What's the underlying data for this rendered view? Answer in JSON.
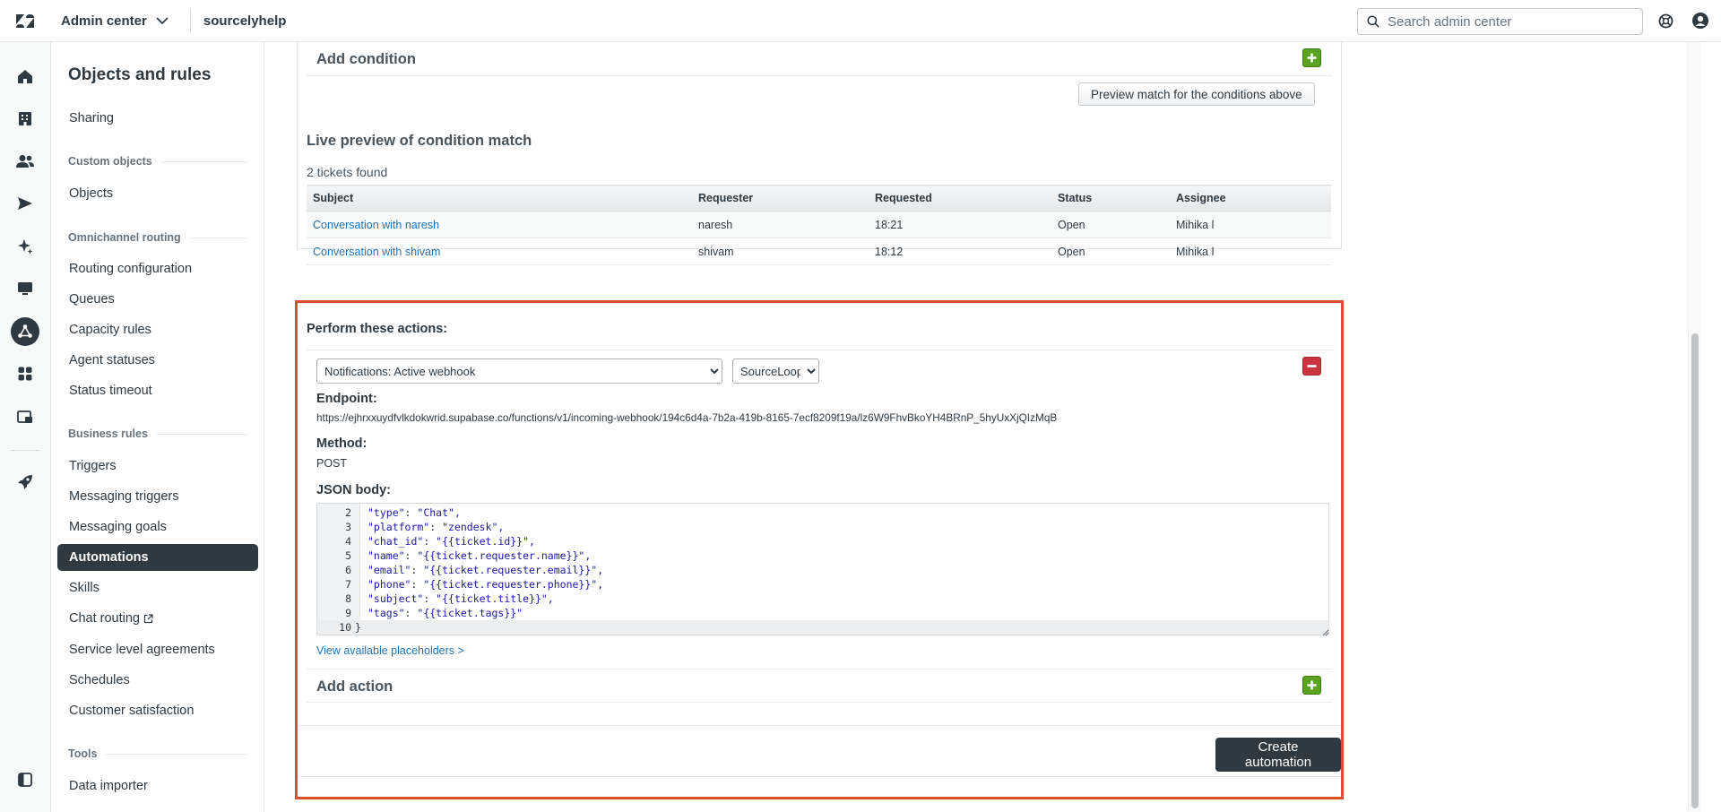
{
  "topbar": {
    "product": "Admin center",
    "account": "sourcelyhelp",
    "search_placeholder": "Search admin center"
  },
  "rail": {
    "icons": [
      "home-icon",
      "building-icon",
      "people-icon",
      "send-icon",
      "sparkle-icon",
      "monitor-icon",
      "objects-rules-icon",
      "apps-icon",
      "workspace-icon",
      "rocket-icon",
      "panel-toggle-icon"
    ]
  },
  "sidebar": {
    "title": "Objects and rules",
    "sharing": "Sharing",
    "custom_objects_group": "Custom objects",
    "objects": "Objects",
    "omnichannel_group": "Omnichannel routing",
    "routing_configuration": "Routing configuration",
    "queues": "Queues",
    "capacity_rules": "Capacity rules",
    "agent_statuses": "Agent statuses",
    "status_timeout": "Status timeout",
    "business_rules_group": "Business rules",
    "triggers": "Triggers",
    "messaging_triggers": "Messaging triggers",
    "messaging_goals": "Messaging goals",
    "automations": "Automations",
    "skills": "Skills",
    "chat_routing": "Chat routing",
    "sla": "Service level agreements",
    "schedules": "Schedules",
    "customer_satisfaction": "Customer satisfaction",
    "tools_group": "Tools",
    "data_importer": "Data importer"
  },
  "conditions": {
    "add_condition": "Add condition",
    "preview_button": "Preview match for the conditions above",
    "live_preview_title": "Live preview of condition match",
    "found_count": "2 tickets found",
    "columns": {
      "subject": "Subject",
      "requester": "Requester",
      "requested": "Requested",
      "status": "Status",
      "assignee": "Assignee"
    },
    "rows": [
      {
        "subject": "Conversation with naresh",
        "requester": "naresh",
        "requested": "18:21",
        "status": "Open",
        "assignee": "Mihika l"
      },
      {
        "subject": "Conversation with shivam",
        "requester": "shivam",
        "requested": "18:12",
        "status": "Open",
        "assignee": "Mihika l"
      }
    ]
  },
  "actions": {
    "title": "Perform these actions:",
    "action_select": "Notifications: Active webhook",
    "webhook_select": "SourceLoop",
    "endpoint_label": "Endpoint:",
    "endpoint_value": "https://ejhrxxuydfvlkdokwrid.supabase.co/functions/v1/incoming-webhook/194c6d4a-7b2a-419b-8165-7ecf8209f19a/lz6W9FhvBkoYH4BRnP_5hyUxXjQIzMqB",
    "method_label": "Method:",
    "method_value": "POST",
    "json_label": "JSON body:",
    "code_lines": [
      {
        "n": "2",
        "key": "\"type\"",
        "val": "\"Chat\","
      },
      {
        "n": "3",
        "key": "\"platform\"",
        "val": "\"zendesk\","
      },
      {
        "n": "4",
        "key": "\"chat_id\"",
        "val": "\"{{ticket.id}}\","
      },
      {
        "n": "5",
        "key": "\"name\"",
        "val": "\"{{ticket.requester.name}}\","
      },
      {
        "n": "6",
        "key": "\"email\"",
        "val": "\"{{ticket.requester.email}}\","
      },
      {
        "n": "7",
        "key": "\"phone\"",
        "val": "\"{{ticket.requester.phone}}\","
      },
      {
        "n": "8",
        "key": "\"subject\"",
        "val": "\"{{ticket.title}}\","
      },
      {
        "n": "9",
        "key": "\"tags\"",
        "val": "\"{{ticket.tags}}\""
      }
    ],
    "last_line_num": "10",
    "last_line_text": "}",
    "placeholders_link": "View available placeholders >",
    "add_action": "Add action",
    "create_button": "Create automation"
  }
}
